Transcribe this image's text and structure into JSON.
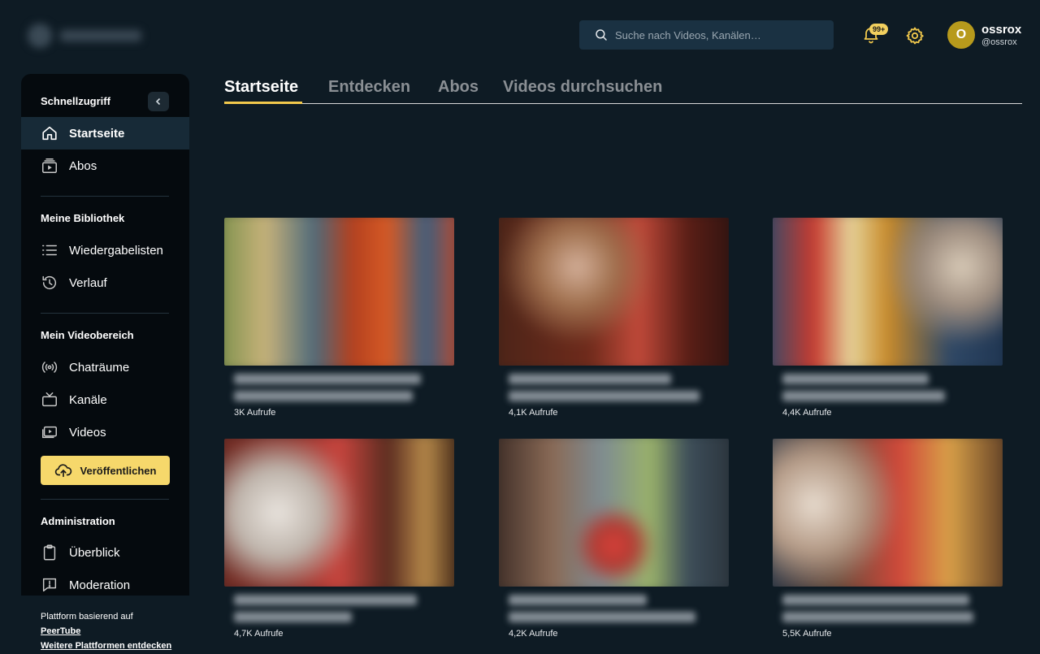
{
  "header": {
    "search_placeholder": "Suche nach Videos, Kanälen…",
    "notification_badge": "99+",
    "avatar_initial": "O",
    "user_name": "ossrox",
    "user_handle": "@ossrox"
  },
  "sidebar": {
    "quick_access_heading": "Schnellzugriff",
    "quick_items": [
      {
        "label": "Startseite",
        "icon": "home-icon",
        "active": true
      },
      {
        "label": "Abos",
        "icon": "subscriptions-icon",
        "active": false
      }
    ],
    "library_heading": "Meine Bibliothek",
    "library_items": [
      {
        "label": "Wiedergabelisten",
        "icon": "playlist-icon"
      },
      {
        "label": "Verlauf",
        "icon": "history-icon"
      }
    ],
    "video_space_heading": "Mein Videobereich",
    "video_space_items": [
      {
        "label": "Chaträume",
        "icon": "broadcast-icon"
      },
      {
        "label": "Kanäle",
        "icon": "tv-icon"
      },
      {
        "label": "Videos",
        "icon": "video-icon"
      }
    ],
    "publish_label": "Veröffentlichen",
    "admin_heading": "Administration",
    "admin_items": [
      {
        "label": "Überblick",
        "icon": "clipboard-icon"
      },
      {
        "label": "Moderation",
        "icon": "moderation-icon"
      }
    ],
    "footer_text": "Plattform basierend auf",
    "footer_link_1": "PeerTube",
    "footer_link_2": "Weitere Plattformen entdecken"
  },
  "tabs": [
    {
      "label": "Startseite",
      "active": true
    },
    {
      "label": "Entdecken",
      "active": false
    },
    {
      "label": "Abos",
      "active": false
    },
    {
      "label": "Videos durchsuchen",
      "active": false
    }
  ],
  "videos": [
    {
      "views": "3K Aufrufe"
    },
    {
      "views": "4,1K Aufrufe"
    },
    {
      "views": "4,4K Aufrufe"
    },
    {
      "views": "4,7K Aufrufe"
    },
    {
      "views": "4,2K Aufrufe"
    },
    {
      "views": "5,5K Aufrufe"
    }
  ],
  "colors": {
    "background": "#0e1b24",
    "sidebar": "#050a0e",
    "accent": "#f2c94c",
    "publish_button": "#f6d86b",
    "avatar": "#b79a1c"
  }
}
